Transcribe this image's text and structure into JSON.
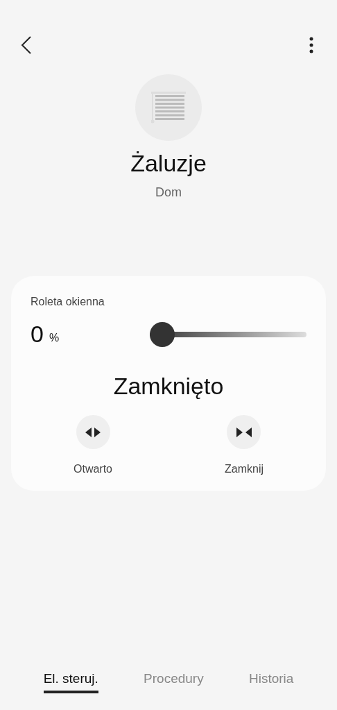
{
  "device": {
    "name": "Żaluzje",
    "room": "Dom"
  },
  "control": {
    "label": "Roleta okienna",
    "value": "0",
    "unit": "%",
    "slider": {
      "level": 0
    },
    "status": "Zamknięto",
    "actions": [
      {
        "kind": "open",
        "label": "Otwarto"
      },
      {
        "kind": "close",
        "label": "Zamknij"
      }
    ]
  },
  "tabs": [
    {
      "label": "El. steruj.",
      "selected": true
    },
    {
      "label": "Procedury",
      "selected": false
    },
    {
      "label": "Historia",
      "selected": false
    }
  ]
}
